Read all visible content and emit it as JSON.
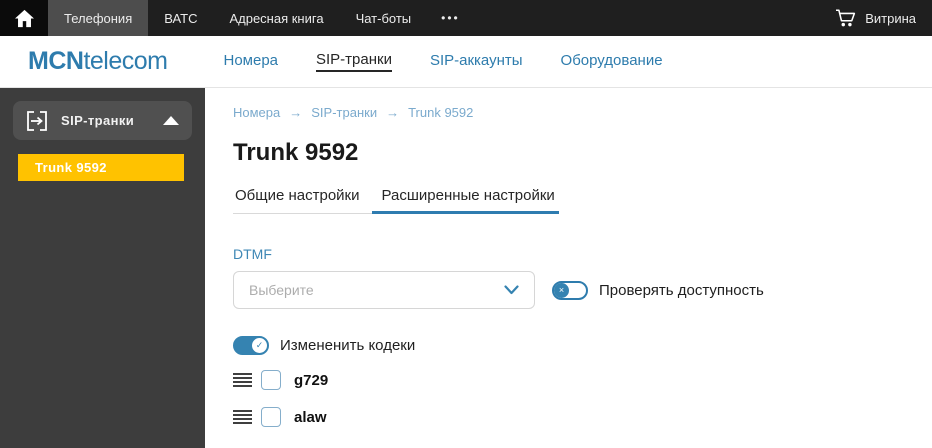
{
  "topbar": {
    "items": [
      {
        "label": "Телефония"
      },
      {
        "label": "ВАТС"
      },
      {
        "label": "Адресная книга"
      },
      {
        "label": "Чат-боты"
      }
    ],
    "more_label": "•••",
    "cart_label": "Витрина"
  },
  "header": {
    "logo_bold": "MCN",
    "logo_regular": "telecom",
    "nav": [
      {
        "label": "Номера"
      },
      {
        "label": "SIP-транки"
      },
      {
        "label": "SIP-аккаунты"
      },
      {
        "label": "Оборудование"
      }
    ]
  },
  "sidebar": {
    "group_label": "SIP-транки",
    "items": [
      {
        "label": "Trunk 9592"
      }
    ]
  },
  "main": {
    "breadcrumb": [
      "Номера",
      "SIP-транки",
      "Trunk 9592"
    ],
    "breadcrumb_separator": "→",
    "title": "Trunk 9592",
    "tabs": [
      {
        "label": "Общие настройки"
      },
      {
        "label": "Расширенные настройки"
      }
    ],
    "form": {
      "dtmf_label": "DTMF",
      "dtmf_placeholder": "Выберите",
      "availability_toggle_label": "Проверять доступность",
      "availability_toggle_state": "off",
      "codecs_toggle_label": "Измененить кодеки",
      "codecs_toggle_state": "on",
      "codecs": [
        {
          "name": "g729",
          "checked": false
        },
        {
          "name": "alaw",
          "checked": false
        }
      ]
    }
  },
  "icons": {
    "toggle_off_glyph": "×",
    "toggle_on_glyph": "✓"
  },
  "colors": {
    "accent_blue": "#2e7cad",
    "tab_underline_blue": "#2e7cb0",
    "sidebar_active_yellow": "#ffc200",
    "topbar_bg": "#1f1f1f",
    "sidebar_bg": "#3d3d3d"
  }
}
